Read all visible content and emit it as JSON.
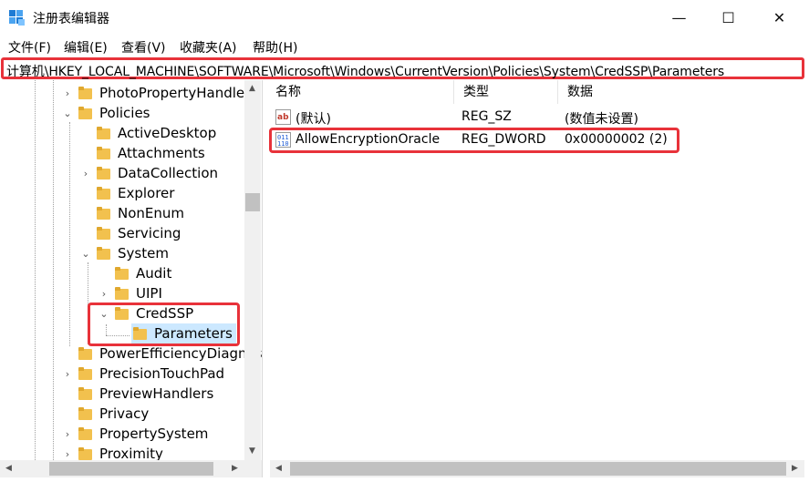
{
  "window": {
    "title": "注册表编辑器",
    "minimize_label": "—",
    "maximize_label": "☐",
    "close_label": "✕"
  },
  "menu": {
    "items": [
      "文件(F)",
      "编辑(E)",
      "查看(V)",
      "收藏夹(A)",
      "帮助(H)"
    ]
  },
  "address": {
    "path": "计算机\\HKEY_LOCAL_MACHINE\\SOFTWARE\\Microsoft\\Windows\\CurrentVersion\\Policies\\System\\CredSSP\\Parameters"
  },
  "tree": {
    "items": [
      {
        "label": "PhotoPropertyHandler"
      },
      {
        "label": "Policies"
      },
      {
        "label": "ActiveDesktop"
      },
      {
        "label": "Attachments"
      },
      {
        "label": "DataCollection"
      },
      {
        "label": "Explorer"
      },
      {
        "label": "NonEnum"
      },
      {
        "label": "Servicing"
      },
      {
        "label": "System"
      },
      {
        "label": "Audit"
      },
      {
        "label": "UIPI"
      },
      {
        "label": "CredSSP"
      },
      {
        "label": "Parameters"
      },
      {
        "label": "PowerEfficiencyDiagnostics"
      },
      {
        "label": "PrecisionTouchPad"
      },
      {
        "label": "PreviewHandlers"
      },
      {
        "label": "Privacy"
      },
      {
        "label": "PropertySystem"
      },
      {
        "label": "Proximity"
      }
    ]
  },
  "list": {
    "columns": [
      "名称",
      "类型",
      "数据"
    ],
    "rows": [
      {
        "icon": "string-value-icon",
        "name": "(默认)",
        "type": "REG_SZ",
        "data": "(数值未设置)"
      },
      {
        "icon": "binary-value-icon",
        "name": "AllowEncryptionOracle",
        "type": "REG_DWORD",
        "data": "0x00000002 (2)"
      }
    ]
  },
  "icons": {
    "app": "regedit-icon",
    "folder": "folder-icon",
    "expand": "chevron-right-icon",
    "collapse": "chevron-down-icon"
  },
  "colors": {
    "highlight": "#e8323a",
    "folder": "#f2c14e",
    "selection": "#cce8ff"
  }
}
